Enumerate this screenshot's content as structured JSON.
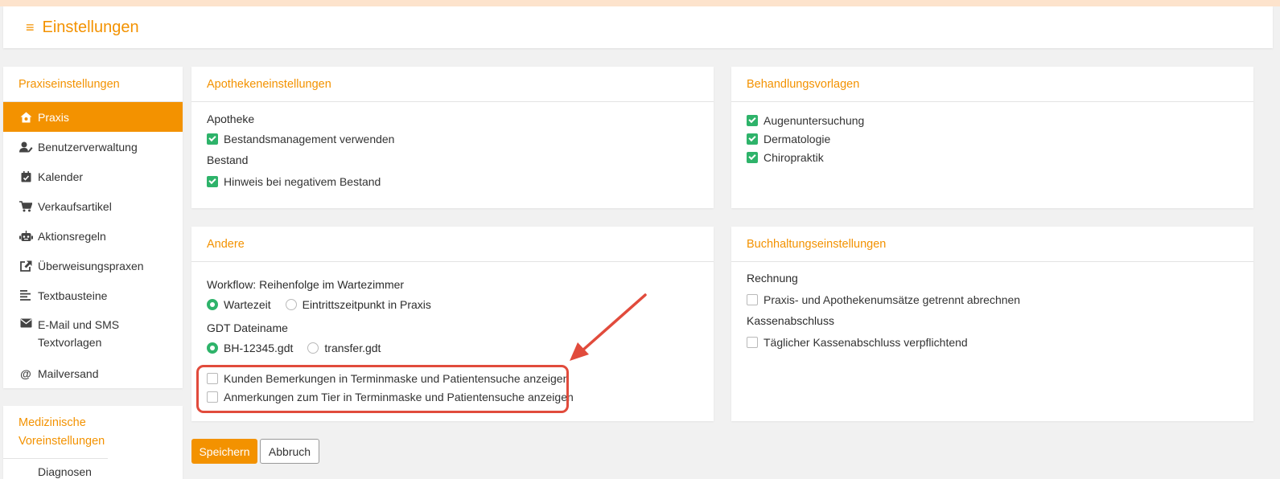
{
  "header": {
    "title": "Einstellungen",
    "menu_icon": "≡"
  },
  "sidebar": {
    "heading": "Praxiseinstellungen",
    "items": [
      {
        "label": "Praxis",
        "icon": "home-settings-icon"
      },
      {
        "label": "Benutzerverwaltung",
        "icon": "user-edit-icon"
      },
      {
        "label": "Kalender",
        "icon": "calendar-check-icon"
      },
      {
        "label": "Verkaufsartikel",
        "icon": "cart-icon"
      },
      {
        "label": "Aktionsregeln",
        "icon": "robot-icon"
      },
      {
        "label": "Überweisungspraxen",
        "icon": "share-icon"
      },
      {
        "label": "Textbausteine",
        "icon": "text-lines-icon"
      },
      {
        "label": "E-Mail und SMS Textvorlagen",
        "icon": "envelope-icon"
      },
      {
        "label": "Mailversand",
        "icon": "at-icon"
      }
    ]
  },
  "sidebar2": {
    "heading": "Medizinische Voreinstellungen",
    "partial_item": "Diagnosen"
  },
  "apotheke": {
    "heading": "Apothekeneinstellungen",
    "section1": "Apotheke",
    "check1": {
      "label": "Bestandsmanagement verwenden",
      "checked": true
    },
    "section2": "Bestand",
    "check2": {
      "label": "Hinweis bei negativem Bestand",
      "checked": true
    }
  },
  "behandlung": {
    "heading": "Behandlungsvorlagen",
    "items": [
      {
        "label": "Augenuntersuchung",
        "checked": true
      },
      {
        "label": "Dermatologie",
        "checked": true
      },
      {
        "label": "Chiropraktik",
        "checked": true
      }
    ]
  },
  "andere": {
    "heading": "Andere",
    "workflow_label": "Workflow: Reihenfolge im Wartezimmer",
    "workflow_options": [
      {
        "label": "Wartezeit",
        "selected": true
      },
      {
        "label": "Eintrittszeitpunkt in Praxis",
        "selected": false
      }
    ],
    "gdt_label": "GDT Dateiname",
    "gdt_options": [
      {
        "label": "BH-12345.gdt",
        "selected": true
      },
      {
        "label": "transfer.gdt",
        "selected": false
      }
    ],
    "check1": {
      "label": "Kunden Bemerkungen in Terminmaske und Patientensuche anzeigen",
      "checked": false
    },
    "check2": {
      "label": "Anmerkungen zum Tier in Terminmaske und Patientensuche anzeigen",
      "checked": false
    }
  },
  "buchhaltung": {
    "heading": "Buchhaltungseinstellungen",
    "section1": "Rechnung",
    "check1": {
      "label": "Praxis- und Apothekenumsätze getrennt abrechnen",
      "checked": false
    },
    "section2": "Kassenabschluss",
    "check2": {
      "label": "Täglicher Kassenabschluss verpflichtend",
      "checked": false
    }
  },
  "buttons": {
    "save": "Speichern",
    "cancel": "Abbruch"
  },
  "colors": {
    "accent": "#f39200",
    "check_green": "#2eb36a",
    "highlight_red": "#e14b3c"
  }
}
